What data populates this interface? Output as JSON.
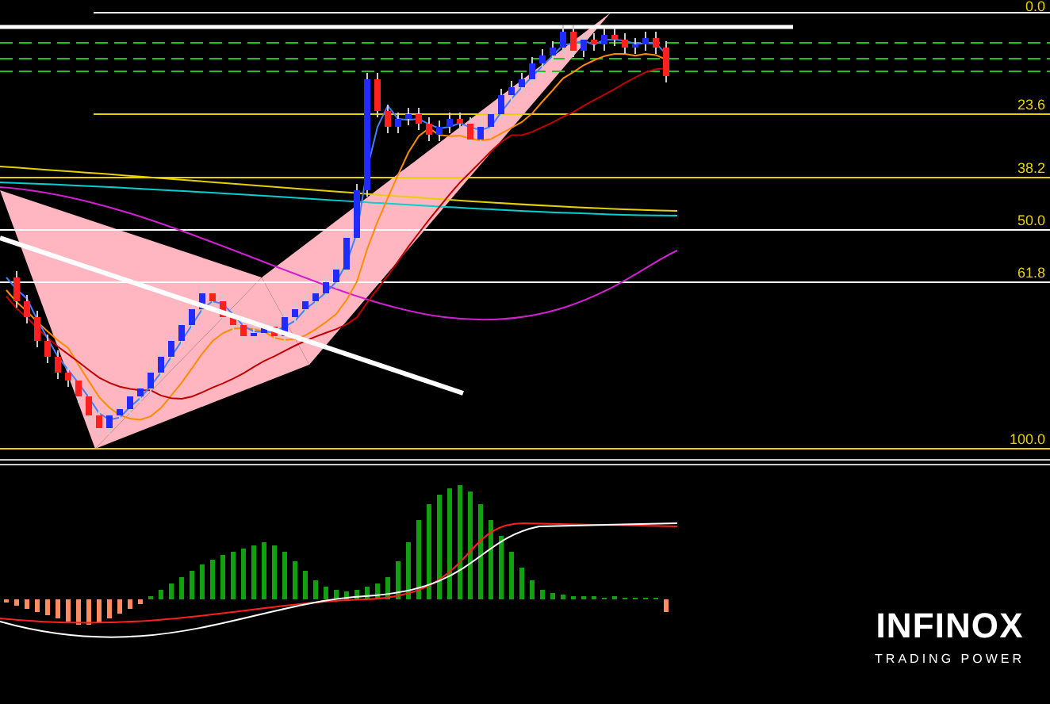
{
  "chart": {
    "fib_levels": [
      {
        "label": "0.0"
      },
      {
        "label": "23.6"
      },
      {
        "label": "38.2"
      },
      {
        "label": "50.0"
      },
      {
        "label": "61.8"
      },
      {
        "label": "100.0"
      }
    ]
  },
  "logo": {
    "name": "INFINOX",
    "tagline": "TRADING POWER"
  }
}
